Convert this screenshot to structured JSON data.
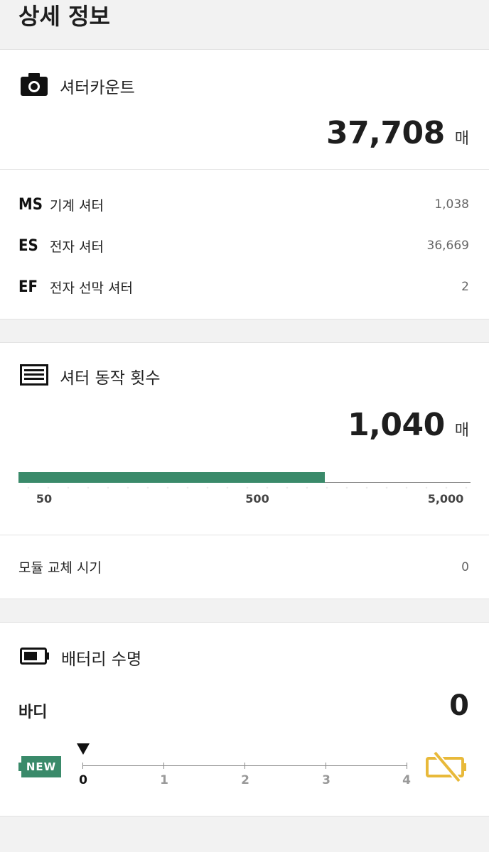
{
  "header": {
    "title": "상세 정보"
  },
  "shutter_count": {
    "title": "셔터카운트",
    "value": "37,708",
    "unit": "매",
    "rows": [
      {
        "code": "MS",
        "label": "기계 셔터",
        "value": "1,038"
      },
      {
        "code": "ES",
        "label": "전자 셔터",
        "value": "36,669"
      },
      {
        "code": "EF",
        "label": "전자 선막 셔터",
        "value": "2"
      }
    ],
    "icon": "camera-icon"
  },
  "shutter_actuation": {
    "title": "셔터 동작 횟수",
    "value": "1,040",
    "unit": "매",
    "icon": "shutter-icon",
    "bar": {
      "scale_labels": [
        "50",
        "500",
        "5,000"
      ],
      "level": 1040,
      "color": "#3a8a6a"
    },
    "module": {
      "label": "모듈 교체 시기",
      "value": "0"
    }
  },
  "battery": {
    "title": "배터리 수명",
    "icon": "battery-icon",
    "body_label": "바디",
    "body_value": "0",
    "badge": "NEW",
    "scale_labels": [
      "0",
      "1",
      "2",
      "3",
      "4"
    ],
    "current_level": 0,
    "alert_icon": "battery-alert-icon",
    "alert_color": "#e8b93a"
  }
}
